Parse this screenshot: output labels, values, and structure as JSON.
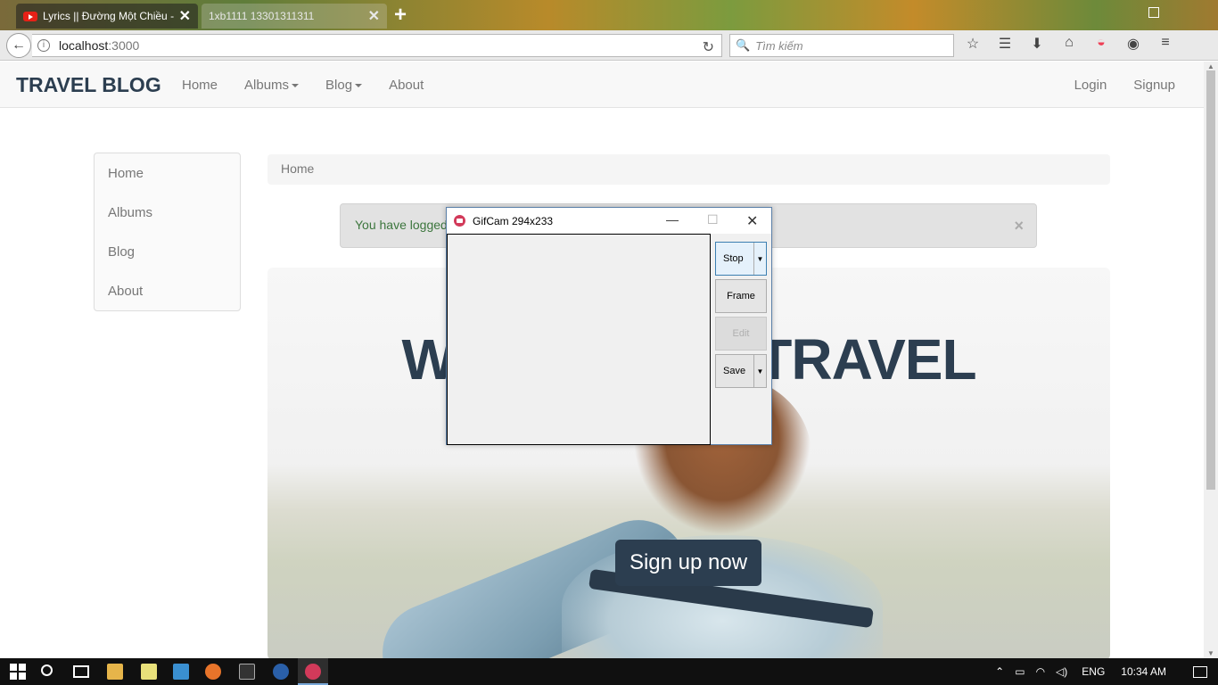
{
  "browser": {
    "tabs": [
      {
        "label": "Lyrics || Đường Một Chiều -",
        "active": false
      },
      {
        "label": "1xb1111 13301311311",
        "active": true
      }
    ],
    "url_host": "localhost",
    "url_port": ":3000",
    "search_placeholder": "Tìm kiếm"
  },
  "site": {
    "brand": "TRAVEL BLOG",
    "nav": {
      "home": "Home",
      "albums": "Albums",
      "blog": "Blog",
      "about": "About"
    },
    "auth": {
      "login": "Login",
      "signup": "Signup"
    }
  },
  "sidebar": {
    "items": [
      {
        "label": "Home"
      },
      {
        "label": "Albums"
      },
      {
        "label": "Blog"
      },
      {
        "label": "About"
      }
    ]
  },
  "breadcrumb": {
    "label": "Home"
  },
  "alert": {
    "message": "You have logged",
    "close": "×"
  },
  "hero": {
    "title_line1": "WELCOME T   TRAVEL",
    "title_line2": "BLC",
    "cta": "Sign up now"
  },
  "gifcam": {
    "title": "GifCam 294x233",
    "buttons": {
      "stop": "Stop",
      "frame": "Frame",
      "edit": "Edit",
      "save": "Save"
    }
  },
  "taskbar": {
    "lang": "ENG",
    "time": "10:34 AM"
  }
}
